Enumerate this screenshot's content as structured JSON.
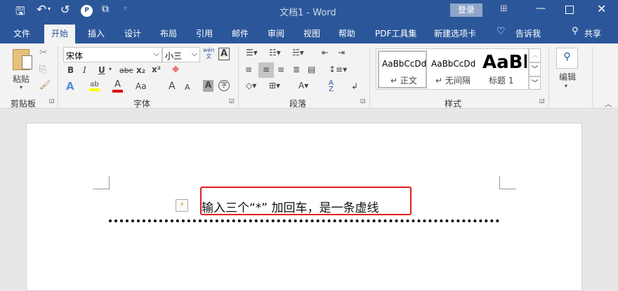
{
  "title": {
    "doc": "文档1",
    "sep": "-",
    "app": "Word",
    "login": "登录"
  },
  "tabs": [
    "文件",
    "开始",
    "插入",
    "设计",
    "布局",
    "引用",
    "邮件",
    "审阅",
    "视图",
    "帮助",
    "PDF工具集",
    "新建选项卡"
  ],
  "tell_me": "告诉我",
  "share": "共享",
  "clipboard": {
    "paste": "粘贴",
    "group": "剪贴板"
  },
  "font": {
    "name": "宋体",
    "size": "小三",
    "group": "字体",
    "bold": "B",
    "italic": "I",
    "underline": "U",
    "strike": "abc",
    "sub": "x₂",
    "sup": "x²",
    "case": "Aa",
    "phonetic": "wén",
    "phonetic2": "文"
  },
  "paragraph": {
    "group": "段落"
  },
  "styles": {
    "group": "样式",
    "items": [
      {
        "preview": "AaBbCcDd",
        "label": "↵ 正文"
      },
      {
        "preview": "AaBbCcDd",
        "label": "↵ 无间隔"
      },
      {
        "preview": "AaBl",
        "label": "标题 1"
      }
    ]
  },
  "editing": {
    "label": "编辑"
  },
  "document": {
    "text": "输入三个“*” 加回车，是一条虚线"
  },
  "colors": {
    "accent": "#2b579a",
    "highlight": "#ffff00",
    "font_color": "#e00000",
    "callout": "#e02020"
  }
}
